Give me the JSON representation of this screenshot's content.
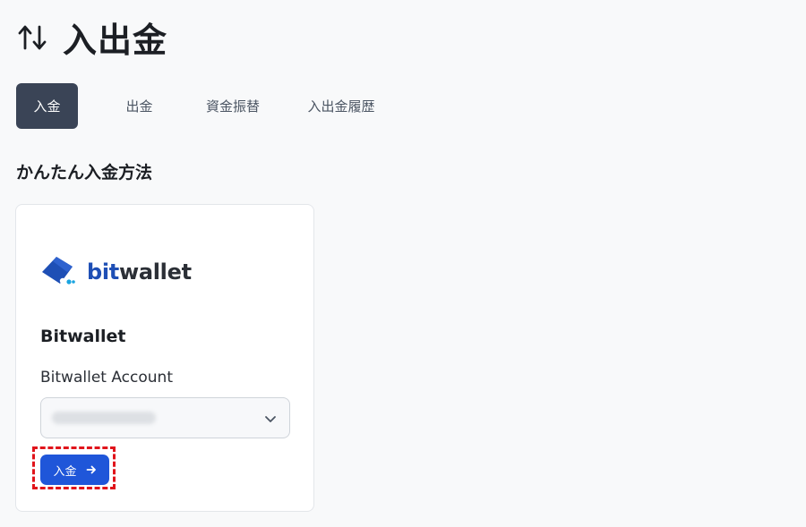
{
  "header": {
    "icon": "swap-vertical-icon",
    "title": "入出金"
  },
  "tabs": [
    {
      "label": "入金",
      "active": true
    },
    {
      "label": "出金",
      "active": false
    },
    {
      "label": "資金振替",
      "active": false
    },
    {
      "label": "入出金履歴",
      "active": false
    }
  ],
  "section": {
    "title": "かんたん入金方法"
  },
  "card": {
    "brand": {
      "icon": "bitwallet-logo-icon",
      "text_part1": "bit",
      "text_part2": "wallet",
      "color_primary": "#1e4fb5",
      "color_dark": "#2b2f36"
    },
    "method_name": "Bitwallet",
    "account_label": "Bitwallet Account",
    "account_select": {
      "value": "",
      "icon": "chevron-down-icon"
    },
    "deposit_button": {
      "label": "入金",
      "icon": "arrow-right-icon",
      "color": "#1f56d9"
    }
  },
  "annotation": {
    "highlight_color": "#e0141b"
  }
}
